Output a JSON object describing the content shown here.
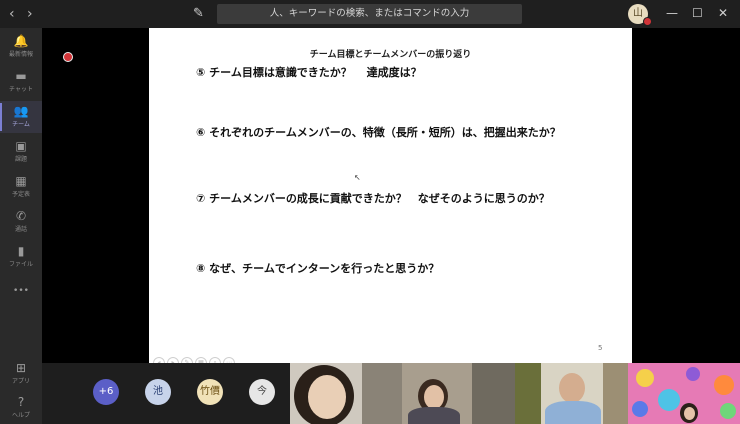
{
  "topbar": {
    "back_glyph": "‹",
    "forward_glyph": "›",
    "search_placeholder": "人、キーワードの検索、またはコマンドの入力",
    "avatar_initial": "山",
    "minimize_glyph": "—",
    "maximize_glyph": "☐",
    "close_glyph": "✕"
  },
  "sidebar": {
    "items": [
      {
        "label": "最新情報",
        "icon": "bell-icon",
        "glyph": "🔔"
      },
      {
        "label": "チャット",
        "icon": "chat-icon",
        "glyph": "▬"
      },
      {
        "label": "チーム",
        "icon": "teams-icon",
        "glyph": "👥"
      },
      {
        "label": "課題",
        "icon": "assignment-icon",
        "glyph": "▣"
      },
      {
        "label": "予定表",
        "icon": "calendar-icon",
        "glyph": "▦"
      },
      {
        "label": "通話",
        "icon": "phone-icon",
        "glyph": "✆"
      },
      {
        "label": "ファイル",
        "icon": "file-icon",
        "glyph": "▮"
      }
    ],
    "more_glyph": "•••",
    "apps_label": "アプリ",
    "apps_glyph": "⊞",
    "help_label": "ヘルプ",
    "help_glyph": "?"
  },
  "slide": {
    "title": "チーム目標とチームメンバーの振り返り",
    "questions": [
      "⑤  チーム目標は意識できたか？　 達成度は？",
      "⑥  それぞれのチームメンバーの、特徴（長所・短所）は、把握出来たか？",
      "⑦  チームメンバーの成長に貢献できたか？　なぜそのように思うのか？",
      "⑧  なぜ、チームでインターンを行ったと思うか？"
    ],
    "page_number": "5"
  },
  "participants": [
    {
      "label": "+6",
      "bg": "#5b5fc7",
      "fg": "#ffffff"
    },
    {
      "label": "池",
      "bg": "#c7d3ea",
      "fg": "#2a3f73"
    },
    {
      "label": "竹價",
      "bg": "#f1e2b8",
      "fg": "#6a4d10"
    },
    {
      "label": "今",
      "bg": "#e6e6e6",
      "fg": "#444444"
    }
  ],
  "colors": {
    "accent": "#5b5fc7",
    "record": "#d13438"
  }
}
